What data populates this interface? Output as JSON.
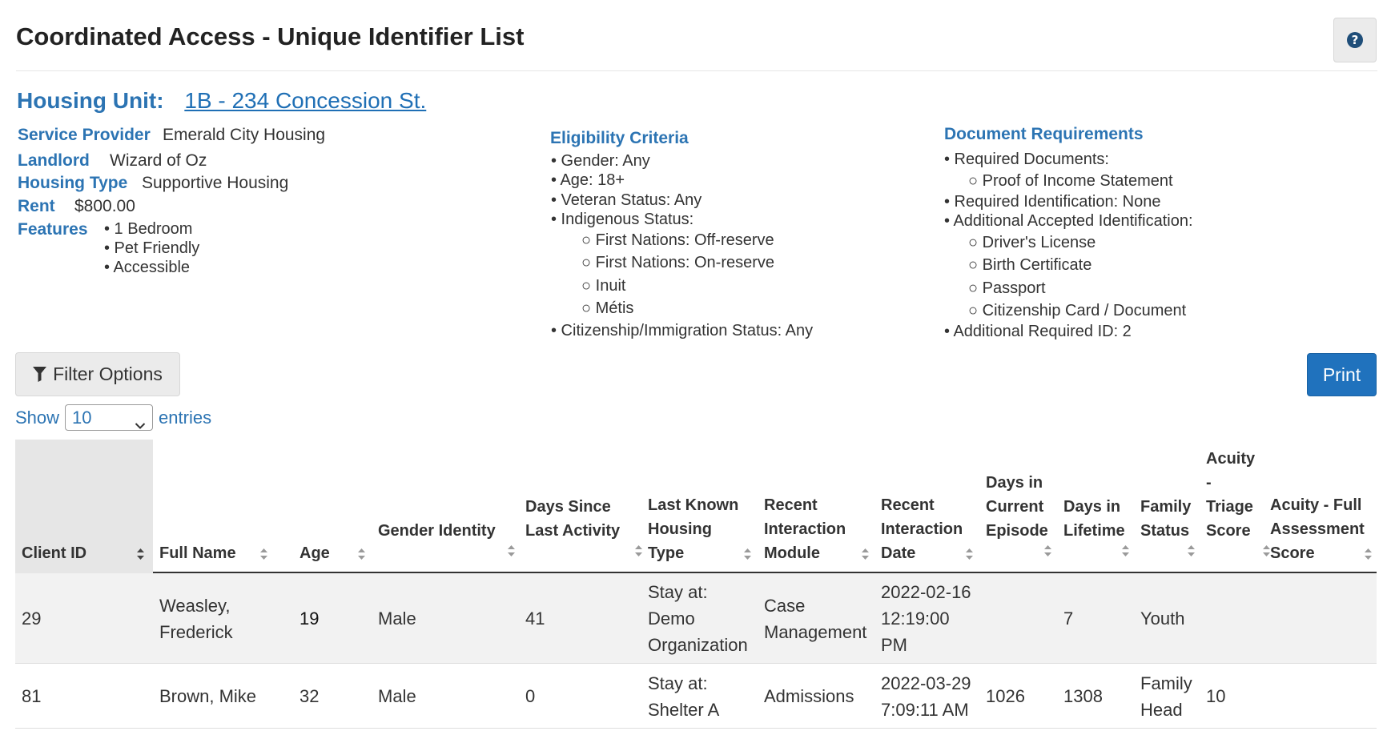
{
  "page": {
    "title": "Coordinated Access - Unique Identifier List",
    "help_icon": "question-circle-icon"
  },
  "housing_unit": {
    "label": "Housing Unit:",
    "link_text": "1B - 234 Concession St."
  },
  "details": {
    "service_provider": {
      "label": "Service Provider",
      "value": "Emerald City Housing"
    },
    "landlord": {
      "label": "Landlord",
      "value": "Wizard of Oz"
    },
    "housing_type": {
      "label": "Housing Type",
      "value": "Supportive Housing"
    },
    "rent": {
      "label": "Rent",
      "value": "$800.00"
    },
    "features": {
      "label": "Features",
      "items": [
        "• 1 Bedroom",
        "• Pet Friendly",
        "• Accessible"
      ]
    }
  },
  "eligibility": {
    "heading": "Eligibility Criteria",
    "lines": [
      "• Gender: Any",
      "• Age: 18+",
      "• Veteran Status: Any",
      "• Indigenous Status:",
      "○ First Nations: Off-reserve",
      "○ First Nations: On-reserve",
      "○ Inuit",
      "○ Métis",
      "• Citizenship/Immigration Status: Any"
    ]
  },
  "documents": {
    "heading": "Document Requirements",
    "lines": [
      "• Required Documents:",
      "○ Proof of Income Statement",
      "• Required Identification: None",
      "• Additional Accepted Identification:",
      "○ Driver's License",
      "○ Birth Certificate",
      "○ Passport",
      "○ Citizenship Card / Document",
      "• Additional Required ID: 2"
    ]
  },
  "controls": {
    "filter_label": "Filter Options",
    "print_label": "Print",
    "show_label": "Show",
    "entries_value": "10",
    "entries_label": "entries"
  },
  "table": {
    "headers": [
      [
        "Client ID"
      ],
      [
        "Full Name"
      ],
      [
        "Age"
      ],
      [
        "Gender Identity"
      ],
      [
        "Days Since",
        "Last Activity"
      ],
      [
        "Last Known",
        "Housing",
        "Type"
      ],
      [
        "Recent",
        "Interaction",
        "Module"
      ],
      [
        "Recent",
        "Interaction",
        "Date"
      ],
      [
        "Days in",
        "Current",
        "Episode"
      ],
      [
        "Days in",
        "Lifetime"
      ],
      [
        "Family",
        "Status"
      ],
      [
        "Acuity",
        "-",
        "Triage",
        "Score"
      ],
      [
        "Acuity - Full",
        "Assessment",
        "Score"
      ]
    ],
    "rows": [
      {
        "client_id": "29",
        "full_name": [
          "Weasley,",
          "Frederick"
        ],
        "age": "19",
        "gender": "Male",
        "days_since": "41",
        "housing_type": [
          "Stay at:",
          "Demo",
          "Organization"
        ],
        "module": [
          "Case",
          "Management"
        ],
        "date": [
          "2022-02-16",
          "12:19:00",
          "PM"
        ],
        "days_episode": "",
        "days_lifetime": "7",
        "family_status": [
          "Youth"
        ],
        "triage": "",
        "full_score": ""
      },
      {
        "client_id": "81",
        "full_name": [
          "Brown, Mike"
        ],
        "age": "32",
        "gender": "Male",
        "days_since": "0",
        "housing_type": [
          "Stay at:",
          "Shelter A"
        ],
        "module": [
          "Admissions"
        ],
        "date": [
          "2022-03-29",
          "7:09:11 AM"
        ],
        "days_episode": "1026",
        "days_lifetime": "1308",
        "family_status": [
          "Family",
          "Head"
        ],
        "triage": "10",
        "full_score": ""
      }
    ]
  }
}
